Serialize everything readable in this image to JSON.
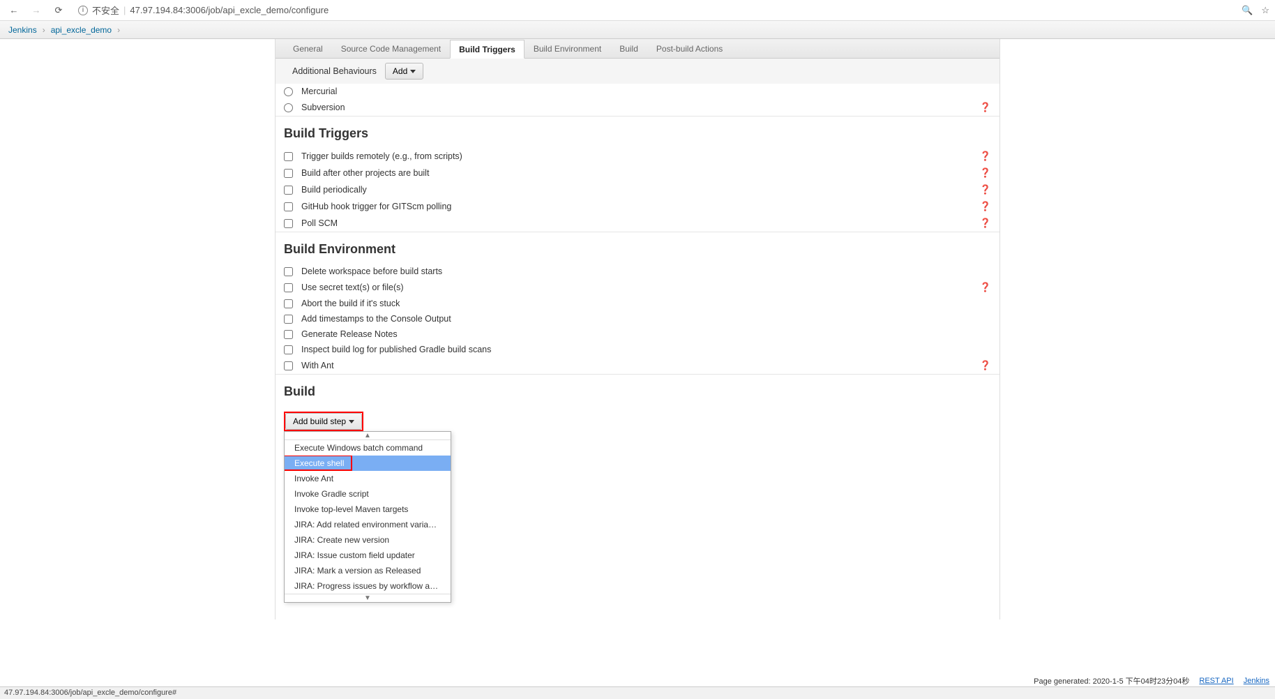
{
  "browser": {
    "insecure_label": "不安全",
    "url": "47.97.194.84:3006/job/api_excle_demo/configure",
    "status_url": "47.97.194.84:3006/job/api_excle_demo/configure#"
  },
  "breadcrumb": {
    "items": [
      "Jenkins",
      "api_excle_demo"
    ]
  },
  "tabs": [
    "General",
    "Source Code Management",
    "Build Triggers",
    "Build Environment",
    "Build",
    "Post-build Actions"
  ],
  "active_tab": "Build Triggers",
  "additional_behaviours": {
    "label": "Additional Behaviours",
    "add_btn": "Add"
  },
  "scm_options": [
    "Mercurial",
    "Subversion"
  ],
  "sections": {
    "build_triggers": {
      "title": "Build Triggers",
      "items": [
        {
          "label": "Trigger builds remotely (e.g., from scripts)",
          "help": true
        },
        {
          "label": "Build after other projects are built",
          "help": true
        },
        {
          "label": "Build periodically",
          "help": true
        },
        {
          "label": "GitHub hook trigger for GITScm polling",
          "help": true
        },
        {
          "label": "Poll SCM",
          "help": true
        }
      ]
    },
    "build_environment": {
      "title": "Build Environment",
      "items": [
        {
          "label": "Delete workspace before build starts",
          "help": false
        },
        {
          "label": "Use secret text(s) or file(s)",
          "help": true
        },
        {
          "label": "Abort the build if it's stuck",
          "help": false
        },
        {
          "label": "Add timestamps to the Console Output",
          "help": false
        },
        {
          "label": "Generate Release Notes",
          "help": false
        },
        {
          "label": "Inspect build log for published Gradle build scans",
          "help": false
        },
        {
          "label": "With Ant",
          "help": true
        }
      ]
    },
    "build": {
      "title": "Build",
      "add_step_btn": "Add build step",
      "dropdown": [
        "Execute Windows batch command",
        "Execute shell",
        "Invoke Ant",
        "Invoke Gradle script",
        "Invoke top-level Maven targets",
        "JIRA: Add related environment variables to build",
        "JIRA: Create new version",
        "JIRA: Issue custom field updater",
        "JIRA: Mark a version as Released",
        "JIRA: Progress issues by workflow action"
      ],
      "highlighted_index": 1
    }
  },
  "footer": {
    "generated": "Page generated: 2020-1-5 下午04时23分04秒",
    "rest_api": "REST API",
    "jenkins": "Jenkins"
  }
}
